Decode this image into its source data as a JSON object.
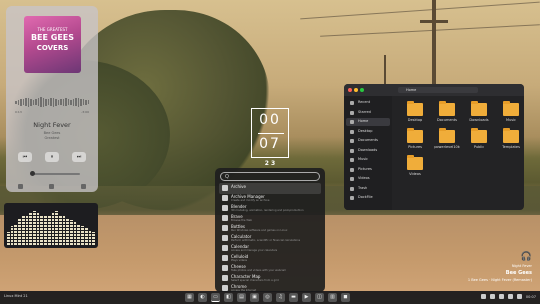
{
  "music": {
    "album_cover": {
      "line1": "THE GREATEST",
      "line2": "BEE GEES",
      "line3": "COVERS"
    },
    "time_elapsed": "0:13",
    "time_total": "-3:00",
    "title": "Night Fever",
    "artist": "Bee Gees",
    "album": "Greatest",
    "controls": {
      "prev": "⏮",
      "play": "⏸",
      "next": "⏭"
    }
  },
  "equalizer": {
    "levels": [
      0.35,
      0.5,
      0.55,
      0.7,
      0.75,
      0.8,
      0.85,
      0.9,
      0.85,
      0.8,
      0.75,
      0.8,
      0.85,
      0.9,
      0.8,
      0.75,
      0.7,
      0.65,
      0.6,
      0.55,
      0.5,
      0.45,
      0.4,
      0.35
    ]
  },
  "clock": {
    "hours": "00",
    "minutes": "07",
    "date": "2 3"
  },
  "launcher": {
    "search_placeholder": "Q",
    "items": [
      {
        "name": "Archive",
        "desc": ""
      },
      {
        "name": "Archive Manager",
        "desc": "Create and modify an archive"
      },
      {
        "name": "Blender",
        "desc": "3D modeling, animation, rendering and post-production"
      },
      {
        "name": "Brave",
        "desc": "Browse the Web"
      },
      {
        "name": "Bottles",
        "desc": "Run Windows software and games on Linux"
      },
      {
        "name": "Calculator",
        "desc": "Perform arithmetic, scientific or financial calculations"
      },
      {
        "name": "Calendar",
        "desc": "Access and manage your calendars"
      },
      {
        "name": "Celluloid",
        "desc": "Plays videos"
      },
      {
        "name": "Cheese",
        "desc": "Take photos and videos with your webcam"
      },
      {
        "name": "Character Map",
        "desc": "Select special characters from a grid"
      },
      {
        "name": "Chrome",
        "desc": "Access the Internet"
      }
    ]
  },
  "file_manager": {
    "path": "Home",
    "sidebar": [
      "Recent",
      "Starred",
      "Home",
      "Desktop",
      "Documents",
      "Downloads",
      "Music",
      "Pictures",
      "Videos",
      "Trash",
      "DockFile"
    ],
    "folders": [
      "Desktop",
      "Documents",
      "Downloads",
      "Music",
      "Pictures",
      "powerlevel10k",
      "Public",
      "Templates",
      "Videos"
    ]
  },
  "now_playing": {
    "icon": "headphones-icon",
    "label": "Night Fever",
    "artist": "Bee Gees",
    "track": "1 Bee Gees · Night Fever (Remaster)"
  },
  "taskbar": {
    "left_text": "Linux Mint 21",
    "apps": [
      "▦",
      "◐",
      "▭",
      "◧",
      "▤",
      "▣",
      "◎",
      "♫",
      "▬",
      "▶",
      "◫",
      "▥",
      "◼"
    ],
    "clock": "00:07"
  }
}
